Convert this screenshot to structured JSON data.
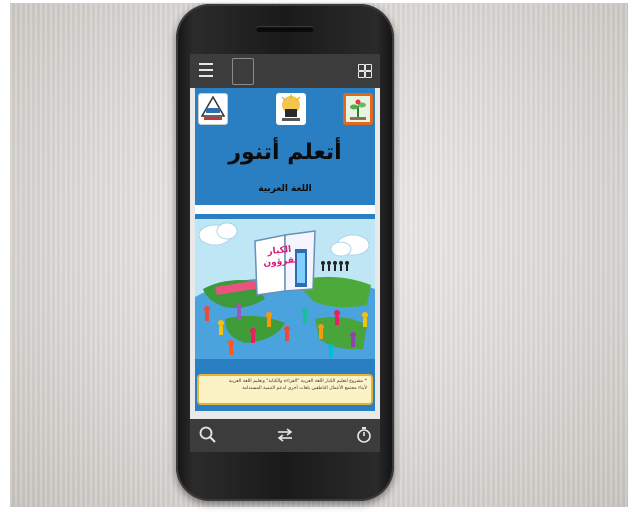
{
  "app": {
    "title": "أتعلم أتنور",
    "subtitle": "اللغة العربية"
  },
  "cover": {
    "book_text_line1": "الكبار",
    "book_text_line2": "يقرؤون"
  },
  "note": {
    "line1": "* مشروع لتعليم الكبار اللغة العربية \"القراءة والكتابة\" وتعليم اللغة العربية",
    "line2": "لأبناء مجتمع الأعمال الناطقين بلغات أخرى لدعم التنمية المستدامة"
  },
  "toolbar": {
    "menu_icon": "hamburger-menu-icon",
    "grid_icon": "grid-view-icon"
  },
  "bottombar": {
    "search_icon": "search-icon",
    "swap_icon": "swap-arrows-icon",
    "timer_icon": "stopwatch-icon"
  },
  "colors": {
    "accent_blue": "#2a7fc3",
    "toolbar_gray": "#3c3c3c",
    "note_background": "#fbf3c6",
    "note_border": "#e7b23a",
    "logo_border_orange": "#e06a1b"
  }
}
